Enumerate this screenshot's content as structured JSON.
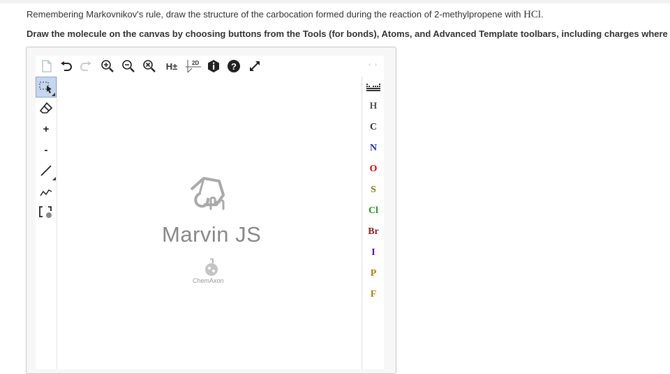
{
  "question": {
    "line1_prefix": "Remembering Markovnikov's rule, draw the structure of the carbocation formed during the reaction of 2-methylpropene with ",
    "line1_reagent": "HCl",
    "line1_suffix": ".",
    "line2": "Draw the molecule on the canvas by choosing buttons from the Tools (for bonds), Atoms, and Advanced Template toolbars, including charges where"
  },
  "top_toolbar": {
    "h_toggle_label": "H±",
    "clean2d_label": "2D",
    "help_label": "?",
    "info_label": "i"
  },
  "left_toolbar": {
    "charge_plus": "+",
    "charge_minus": "-"
  },
  "atoms": [
    {
      "symbol": "H",
      "color": "#555555"
    },
    {
      "symbol": "C",
      "color": "#333333"
    },
    {
      "symbol": "N",
      "color": "#1f2bb8"
    },
    {
      "symbol": "O",
      "color": "#e60000"
    },
    {
      "symbol": "S",
      "color": "#8a7a00"
    },
    {
      "symbol": "Cl",
      "color": "#1a9a1a"
    },
    {
      "symbol": "Br",
      "color": "#8b2020"
    },
    {
      "symbol": "I",
      "color": "#6a0aa0"
    },
    {
      "symbol": "P",
      "color": "#c07800"
    },
    {
      "symbol": "F",
      "color": "#b08000"
    }
  ],
  "right_toolbar": {
    "nav": "‹ ›"
  },
  "canvas": {
    "logo_text": "Marvin JS",
    "logo_sub": "ChemAxon"
  },
  "icons": {
    "new": "document-icon",
    "undo": "undo-icon",
    "redo": "redo-icon",
    "zoom_in": "zoom-in-icon",
    "zoom_out": "zoom-out-icon",
    "zoom_reset": "zoom-reset-icon",
    "fullscreen": "expand-icon",
    "eraser": "eraser-icon",
    "periodic": "periodic-table-icon"
  }
}
